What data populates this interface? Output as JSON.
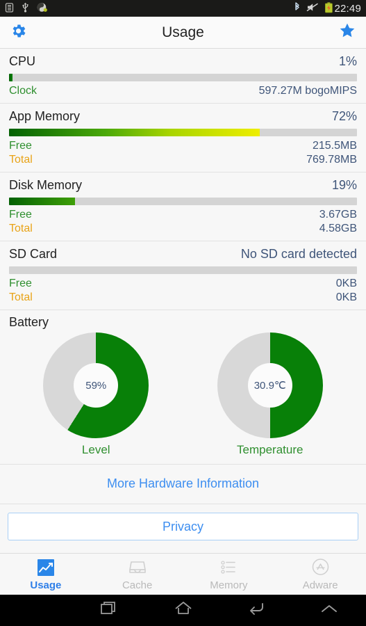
{
  "statusbar": {
    "time": "22:49",
    "left_icons": [
      "sim-card-icon",
      "usb-icon",
      "yin-yang-icon"
    ],
    "right_icons": [
      "bluetooth-icon",
      "volume-muted-icon",
      "battery-charging-icon"
    ]
  },
  "actionbar": {
    "title": "Usage",
    "settings_icon": "gear-icon",
    "favorite_icon": "star-icon"
  },
  "sections": {
    "cpu": {
      "title": "CPU",
      "value": "1%",
      "percent": 1,
      "sub_label": "Clock",
      "sub_value": "597.27M bogoMIPS"
    },
    "app_memory": {
      "title": "App Memory",
      "value": "72%",
      "percent": 72,
      "free_label": "Free",
      "free_value": "215.5MB",
      "total_label": "Total",
      "total_value": "769.78MB"
    },
    "disk_memory": {
      "title": "Disk Memory",
      "value": "19%",
      "percent": 19,
      "free_label": "Free",
      "free_value": "3.67GB",
      "total_label": "Total",
      "total_value": "4.58GB"
    },
    "sd_card": {
      "title": "SD Card",
      "value": "No SD card detected",
      "percent": 0,
      "free_label": "Free",
      "free_value": "0KB",
      "total_label": "Total",
      "total_value": "0KB"
    },
    "battery": {
      "title": "Battery",
      "level": {
        "center_text": "59%",
        "label": "Level",
        "percent": 59
      },
      "temperature": {
        "center_text": "30.9℃",
        "label": "Temperature",
        "percent": 50
      }
    }
  },
  "more_link": "More Hardware Information",
  "privacy_button": "Privacy",
  "tabs": [
    {
      "label": "Usage",
      "icon": "chart-line-icon",
      "active": true
    },
    {
      "label": "Cache",
      "icon": "tray-icon",
      "active": false
    },
    {
      "label": "Memory",
      "icon": "list-icon",
      "active": false
    },
    {
      "label": "Adware",
      "icon": "app-store-icon",
      "active": false
    }
  ],
  "navbar": {
    "recents": "recents-icon",
    "home": "home-icon",
    "back": "back-icon",
    "expand": "chevron-up-icon"
  },
  "colors": {
    "accent_blue": "#3d8ef0",
    "green": "#088008",
    "yellow": "#eeee00",
    "track": "#d4d4d4",
    "value_text": "#3f5579",
    "free_text": "#2f8f2f",
    "total_text": "#e8a317"
  },
  "chart_data": {
    "type": "pie",
    "title": "Battery",
    "charts": [
      {
        "name": "Level",
        "value": 59,
        "unit": "%",
        "filled_pct": 59,
        "colors": [
          "#088008",
          "#d8d8d8"
        ]
      },
      {
        "name": "Temperature",
        "value": 30.9,
        "unit": "℃",
        "filled_pct": 50,
        "colors": [
          "#088008",
          "#d8d8d8"
        ]
      }
    ]
  }
}
